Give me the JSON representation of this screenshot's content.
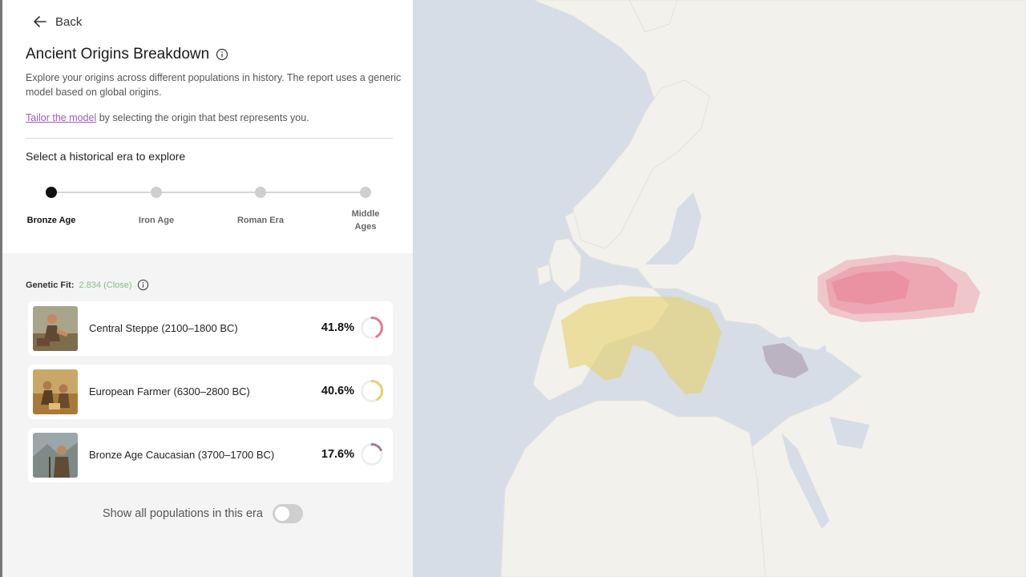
{
  "header": {
    "back_label": "Back",
    "title": "Ancient Origins Breakdown",
    "description": "Explore your origins across different populations in history. The report uses a generic model based on global origins.",
    "tailor_link": "Tailor the model",
    "tailor_rest": " by selecting the origin that best represents you."
  },
  "eras": {
    "prompt": "Select a historical era to explore",
    "items": [
      {
        "label": "Bronze Age",
        "active": true
      },
      {
        "label": "Iron Age",
        "active": false
      },
      {
        "label": "Roman Era",
        "active": false
      },
      {
        "label": "Middle Ages",
        "active": false
      }
    ]
  },
  "fit": {
    "label": "Genetic Fit:",
    "value": "2.834 (Close)",
    "value_color": "#7cc47f"
  },
  "populations": [
    {
      "name": "Central Steppe (2100–1800 BC)",
      "percent_label": "41.8%",
      "percent": 41.8,
      "color": "#e8788f"
    },
    {
      "name": "European Farmer (6300–2800 BC)",
      "percent_label": "40.6%",
      "percent": 40.6,
      "color": "#e6d26a"
    },
    {
      "name": "Bronze Age Caucasian (3700–1700 BC)",
      "percent_label": "17.6%",
      "percent": 17.6,
      "color": "#9c7f96"
    }
  ],
  "toggle": {
    "label": "Show all populations in this era",
    "on": false
  },
  "colors": {
    "accent_link": "#9c5bb8",
    "steppe": "#e8788f",
    "farmer": "#e6d26a",
    "caucasian": "#9c7f96"
  }
}
